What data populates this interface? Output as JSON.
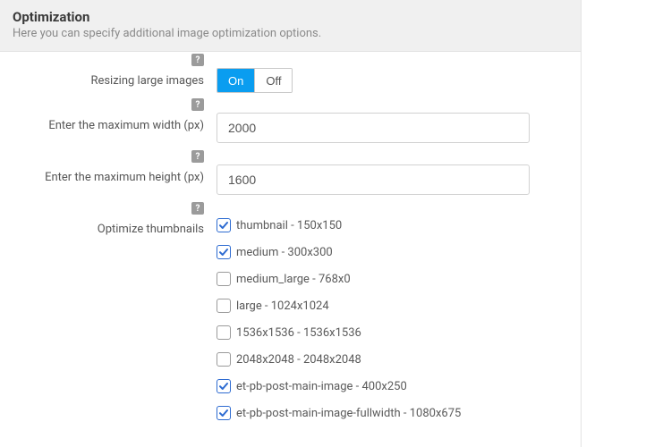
{
  "header": {
    "title": "Optimization",
    "description": "Here you can specify additional image optimization options."
  },
  "labels": {
    "resize": "Resizing large images",
    "max_width": "Enter the maximum width (px)",
    "max_height": "Enter the maximum height (px)",
    "optimize_thumbs": "Optimize thumbnails"
  },
  "toggle": {
    "on": "On",
    "off": "Off"
  },
  "values": {
    "max_width": "2000",
    "max_height": "1600"
  },
  "thumbnails": [
    {
      "label": "thumbnail - 150x150",
      "checked": true
    },
    {
      "label": "medium - 300x300",
      "checked": true
    },
    {
      "label": "medium_large - 768x0",
      "checked": false
    },
    {
      "label": "large - 1024x1024",
      "checked": false
    },
    {
      "label": "1536x1536 - 1536x1536",
      "checked": false
    },
    {
      "label": "2048x2048 - 2048x2048",
      "checked": false
    },
    {
      "label": "et-pb-post-main-image - 400x250",
      "checked": true
    },
    {
      "label": "et-pb-post-main-image-fullwidth - 1080x675",
      "checked": true
    }
  ],
  "help_glyph": "?"
}
